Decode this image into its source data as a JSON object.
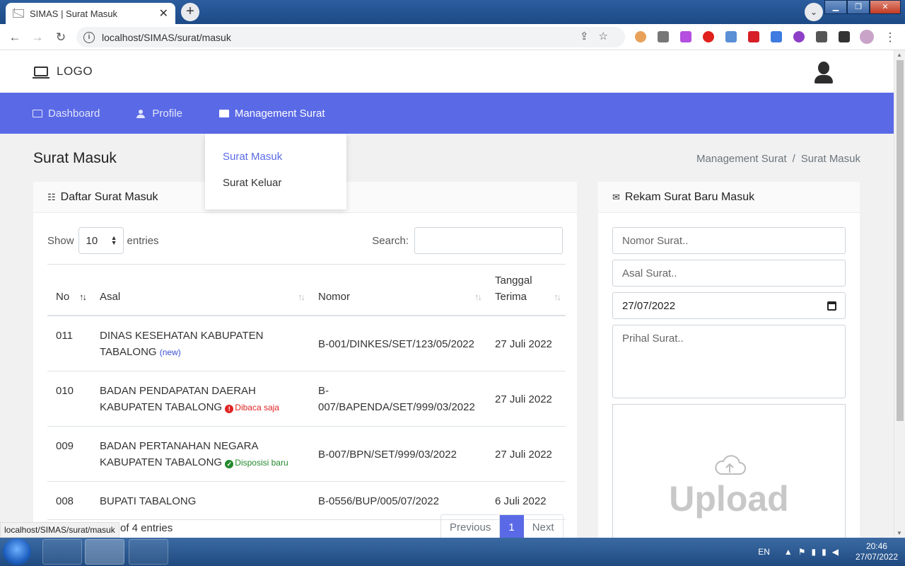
{
  "browser": {
    "tab_title": "SIMAS | Surat Masuk",
    "tab_close": "✕",
    "new_tab": "+",
    "url": "localhost/SIMAS/surat/masuk",
    "status_url": "localhost/SIMAS/surat/masuk"
  },
  "header": {
    "logo": "LOGO"
  },
  "menu": {
    "items": [
      {
        "label": "Dashboard",
        "icon": "monitor-icon"
      },
      {
        "label": "Profile",
        "icon": "user-icon"
      },
      {
        "label": "Management Surat",
        "icon": "mail-icon"
      }
    ],
    "dropdown": [
      "Surat Masuk",
      "Surat Keluar"
    ]
  },
  "page": {
    "title": "Surat Masuk",
    "breadcrumb": [
      "Management Surat",
      "/",
      "Surat Masuk"
    ]
  },
  "list_card": {
    "title": "Daftar Surat Masuk",
    "show_label": "Show",
    "entries_value": "10",
    "entries_label": "entries",
    "search_label": "Search:",
    "columns": [
      "No",
      "Asal",
      "Nomor",
      "Tanggal Terima"
    ],
    "rows": [
      {
        "no": "011",
        "asal": "DINAS KESEHATAN KABUPATEN TABALONG",
        "badge": "(new)",
        "badge_type": "new",
        "nomor": "B-001/DINKES/SET/123/05/2022",
        "tanggal": "27 Juli 2022"
      },
      {
        "no": "010",
        "asal": "BADAN PENDAPATAN DAERAH KABUPATEN TABALONG",
        "badge": "Dibaca saja",
        "badge_type": "read",
        "nomor": "B-007/BAPENDA/SET/999/03/2022",
        "tanggal": "27 Juli 2022"
      },
      {
        "no": "009",
        "asal": "BADAN PERTANAHAN NEGARA KABUPATEN TABALONG",
        "badge": "Disposisi baru",
        "badge_type": "disp",
        "nomor": "B-007/BPN/SET/999/03/2022",
        "tanggal": "27 Juli 2022"
      },
      {
        "no": "008",
        "asal": "BUPATI TABALONG",
        "badge": "",
        "badge_type": "",
        "nomor": "B-0556/BUP/005/07/2022",
        "tanggal": "6 Juli 2022"
      }
    ],
    "info": "of 4 entries",
    "pagination": {
      "previous": "Previous",
      "current": "1",
      "next": "Next"
    }
  },
  "form_card": {
    "title": "Rekam Surat Baru Masuk",
    "nomor_placeholder": "Nomor Surat..",
    "asal_placeholder": "Asal Surat..",
    "date_value": "27/07/2022",
    "prihal_placeholder": "Prihal Surat..",
    "upload_label": "Upload"
  },
  "taskbar": {
    "lang": "EN",
    "time": "20:46",
    "date": "27/07/2022"
  },
  "colors": {
    "accent": "#5a6ae6",
    "badge_new": "#3a4fd8",
    "badge_read": "#e02424",
    "badge_disp": "#23892e"
  }
}
